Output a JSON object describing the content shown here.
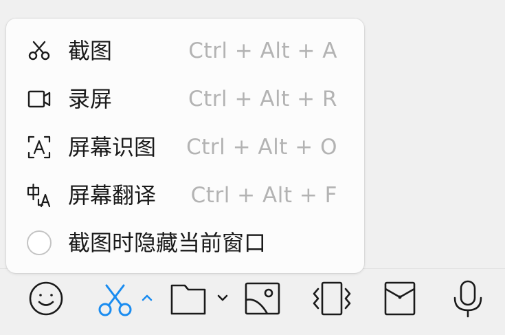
{
  "menu": {
    "items": [
      {
        "icon": "scissors-icon",
        "label": "截图",
        "shortcut": "Ctrl + Alt + A"
      },
      {
        "icon": "screen-record-icon",
        "label": "录屏",
        "shortcut": "Ctrl + Alt + R"
      },
      {
        "icon": "ocr-text-icon",
        "label": "屏幕识图",
        "shortcut": "Ctrl + Alt + O"
      },
      {
        "icon": "translate-icon",
        "label": "屏幕翻译",
        "shortcut": "Ctrl + Alt + F"
      }
    ],
    "hide_window_option": {
      "label": "截图时隐藏当前窗口",
      "checked": false
    }
  },
  "toolbar": {
    "icons": [
      "emoji-icon",
      "screenshot-scissors-icon",
      "chevron-up-icon",
      "folder-icon",
      "chevron-down-icon",
      "image-icon",
      "shake-icon",
      "red-packet-icon",
      "microphone-icon"
    ],
    "active_color": "#1a8cf0"
  }
}
